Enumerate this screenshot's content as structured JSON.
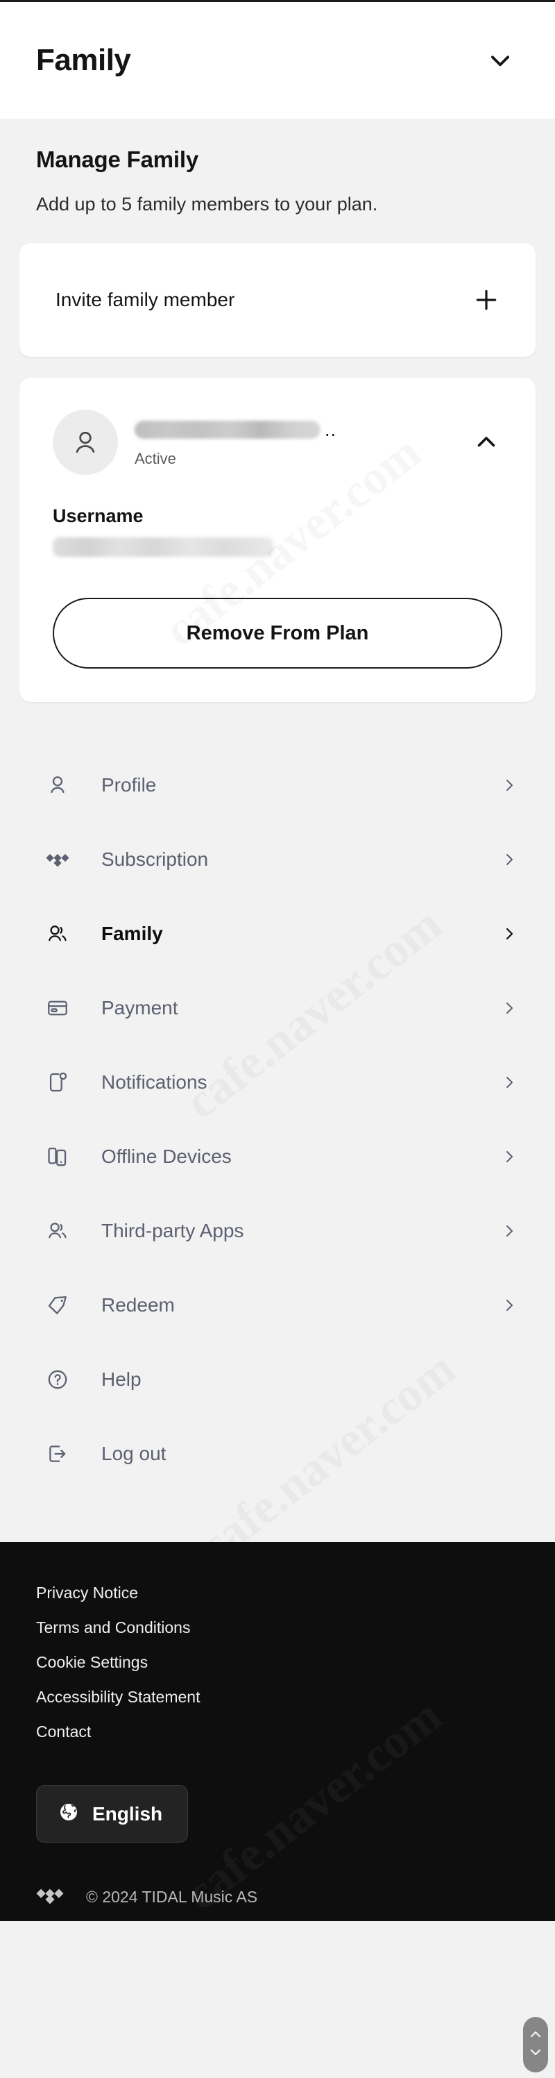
{
  "header": {
    "title": "Family",
    "chevron_icon": "chevron-down-icon"
  },
  "main": {
    "section_title": "Manage Family",
    "section_subtitle": "Add up to 5 family members to your plan.",
    "invite": {
      "label": "Invite family member",
      "icon": "plus-icon"
    },
    "member": {
      "avatar_icon": "person-icon",
      "name": "",
      "name_redacted": true,
      "name_trailing": "..",
      "status": "Active",
      "collapse_icon": "chevron-up-icon",
      "username_label": "Username",
      "username_value": "",
      "username_redacted": true,
      "remove_button": "Remove From Plan"
    }
  },
  "nav": {
    "items": [
      {
        "label": "Profile",
        "icon": "person-icon",
        "active": false,
        "chevron": true
      },
      {
        "label": "Subscription",
        "icon": "tidal-logo-icon",
        "active": false,
        "chevron": true
      },
      {
        "label": "Family",
        "icon": "people-icon",
        "active": true,
        "chevron": true
      },
      {
        "label": "Payment",
        "icon": "credit-card-icon",
        "active": false,
        "chevron": true
      },
      {
        "label": "Notifications",
        "icon": "bell-phone-icon",
        "active": false,
        "chevron": true
      },
      {
        "label": "Offline Devices",
        "icon": "devices-icon",
        "active": false,
        "chevron": true
      },
      {
        "label": "Third-party Apps",
        "icon": "people-icon",
        "active": false,
        "chevron": true
      },
      {
        "label": "Redeem",
        "icon": "tag-icon",
        "active": false,
        "chevron": true
      },
      {
        "label": "Help",
        "icon": "question-circle-icon",
        "active": false,
        "chevron": false
      },
      {
        "label": "Log out",
        "icon": "logout-icon",
        "active": false,
        "chevron": false
      }
    ]
  },
  "footer": {
    "links": [
      "Privacy Notice",
      "Terms and Conditions",
      "Cookie Settings",
      "Accessibility Statement",
      "Contact"
    ],
    "language": {
      "label": "English",
      "icon": "globe-icon"
    },
    "copyright": "© 2024 TIDAL Music AS",
    "brand_icon": "tidal-logo-icon"
  },
  "scroll_control": {
    "up_icon": "chevron-up-icon",
    "down_icon": "chevron-down-icon"
  },
  "colors": {
    "page_bg": "#f2f2f2",
    "card_bg": "#ffffff",
    "text_primary": "#141414",
    "text_muted": "#5c6070",
    "footer_bg": "#0e0e0e"
  },
  "watermark": {
    "text": "cafe.naver.com"
  }
}
